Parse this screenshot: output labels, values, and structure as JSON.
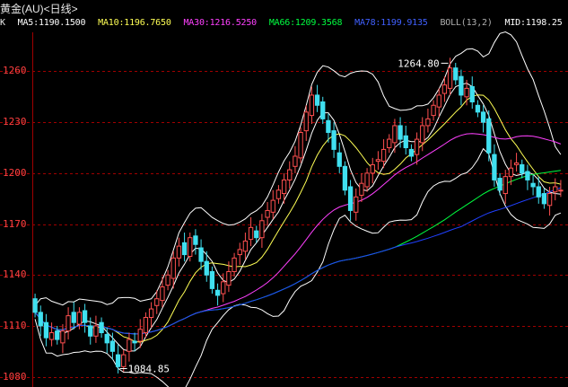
{
  "title": "黄金(AU)<日线>",
  "legend": {
    "k_label": "K",
    "items": [
      {
        "text": "MA5:1190.1500",
        "color": "#ffffff"
      },
      {
        "text": "MA10:1196.7650",
        "color": "#ffff55"
      },
      {
        "text": "MA30:1216.5250",
        "color": "#ff40ff"
      },
      {
        "text": "MA66:1209.3568",
        "color": "#00ff40"
      },
      {
        "text": "MA78:1199.9135",
        "color": "#4060ff"
      },
      {
        "text": "BOLL(13,2)",
        "color": "#b0b0b0"
      },
      {
        "text": "MID:1198.25",
        "color": "#ffffff"
      }
    ]
  },
  "chart_data": {
    "type": "candlestick",
    "y_ticks": [
      1080,
      1110,
      1140,
      1170,
      1200,
      1230,
      1260
    ],
    "ylim": [
      1074,
      1283
    ],
    "grid": true,
    "annotations": [
      {
        "text": "1264.80",
        "value": 1264.8
      },
      {
        "text": "1084.85",
        "value": 1084.85
      }
    ],
    "colors": {
      "up": "#ff5050",
      "down": "#40e0f0",
      "grid": "#a00000",
      "boll": "#ffffff",
      "ma5": "#ffffff",
      "ma10": "#ffff55",
      "ma30": "#ff40ff",
      "ma66": "#00ff40",
      "ma78": "#2040ff"
    },
    "closes": [
      1118,
      1110,
      1103,
      1106,
      1102,
      1107,
      1116,
      1112,
      1118,
      1112,
      1104,
      1110,
      1106,
      1100,
      1095,
      1086,
      1093,
      1102,
      1100,
      1108,
      1115,
      1120,
      1126,
      1133,
      1140,
      1150,
      1157,
      1152,
      1162,
      1158,
      1148,
      1140,
      1132,
      1128,
      1136,
      1142,
      1150,
      1155,
      1160,
      1168,
      1162,
      1172,
      1178,
      1184,
      1190,
      1196,
      1202,
      1210,
      1224,
      1236,
      1246,
      1240,
      1232,
      1224,
      1214,
      1204,
      1190,
      1178,
      1186,
      1194,
      1200,
      1205,
      1208,
      1214,
      1220,
      1228,
      1220,
      1215,
      1210,
      1220,
      1228,
      1232,
      1240,
      1246,
      1252,
      1262,
      1255,
      1246,
      1250,
      1242,
      1236,
      1230,
      1212,
      1196,
      1190,
      1198,
      1203,
      1206,
      1200,
      1196,
      1192,
      1186,
      1182,
      1188,
      1192,
      1190
    ]
  }
}
